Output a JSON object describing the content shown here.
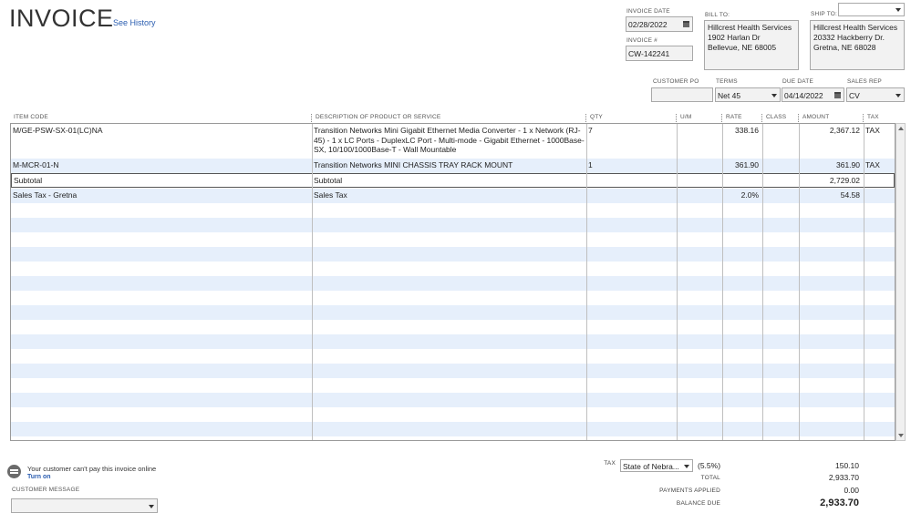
{
  "header": {
    "title": "INVOICE",
    "see_history": "See History"
  },
  "invoice_date": {
    "label": "INVOICE DATE",
    "value": "02/28/2022"
  },
  "invoice_number": {
    "label": "INVOICE #",
    "value": "CW-142241"
  },
  "bill_to": {
    "label": "BILL TO:",
    "lines": [
      "Hillcrest Health Services",
      "1902 Harlan Dr",
      "Bellevue, NE 68005"
    ]
  },
  "ship_to": {
    "label": "SHIP TO:",
    "dropdown_value": "",
    "lines": [
      "Hillcrest Health Services",
      "20332 Hackberry Dr.",
      "Gretna, NE 68028"
    ]
  },
  "customer_po": {
    "label": "CUSTOMER PO",
    "value": ""
  },
  "terms": {
    "label": "TERMS",
    "value": "Net 45"
  },
  "due_date": {
    "label": "DUE DATE",
    "value": "04/14/2022"
  },
  "sales_rep": {
    "label": "SALES REP",
    "value": "CV"
  },
  "columns": [
    "ITEM CODE",
    "DESCRIPTION OF PRODUCT OR SERVICE",
    "QTY",
    "U/M",
    "RATE",
    "CLASS",
    "AMOUNT",
    "TAX"
  ],
  "line_items": [
    {
      "item_code": "M/GE-PSW-SX-01(LC)NA",
      "description": "Transition Networks Mini Gigabit Ethernet Media Converter - 1 x Network (RJ-45) - 1 x LC Ports - DuplexLC Port - Multi-mode - Gigabit Ethernet - 1000Base-SX, 10/100/1000Base-T - Wall Mountable",
      "qty": "7",
      "um": "",
      "rate": "338.16",
      "class": "",
      "amount": "2,367.12",
      "tax": "TAX"
    },
    {
      "item_code": "M-MCR-01-N",
      "description": "Transition Networks MINI CHASSIS TRAY RACK MOUNT",
      "qty": "1",
      "um": "",
      "rate": "361.90",
      "class": "",
      "amount": "361.90",
      "tax": "TAX"
    },
    {
      "item_code": "Subtotal",
      "description": "Subtotal",
      "qty": "",
      "um": "",
      "rate": "",
      "class": "",
      "amount": "2,729.02",
      "tax": ""
    },
    {
      "item_code": "Sales Tax - Gretna",
      "description": "Sales Tax",
      "qty": "",
      "um": "",
      "rate": "2.0%",
      "class": "",
      "amount": "54.58",
      "tax": ""
    }
  ],
  "online_payment": {
    "message": "Your customer can't pay this invoice online",
    "turn_on": "Turn on"
  },
  "customer_message": {
    "label": "CUSTOMER MESSAGE",
    "value": ""
  },
  "tax": {
    "label": "TAX",
    "select_value": "State of Nebra...",
    "rate": "(5.5%)",
    "amount": "150.10"
  },
  "totals": {
    "total_label": "TOTAL",
    "total_value": "2,933.70",
    "payments_label": "PAYMENTS APPLIED",
    "payments_value": "0.00",
    "balance_label": "BALANCE DUE",
    "balance_value": "2,933.70"
  },
  "colors": {
    "row_alt": "#e6effb",
    "link": "#2a5db0",
    "field_bg": "#f2f2f2"
  }
}
